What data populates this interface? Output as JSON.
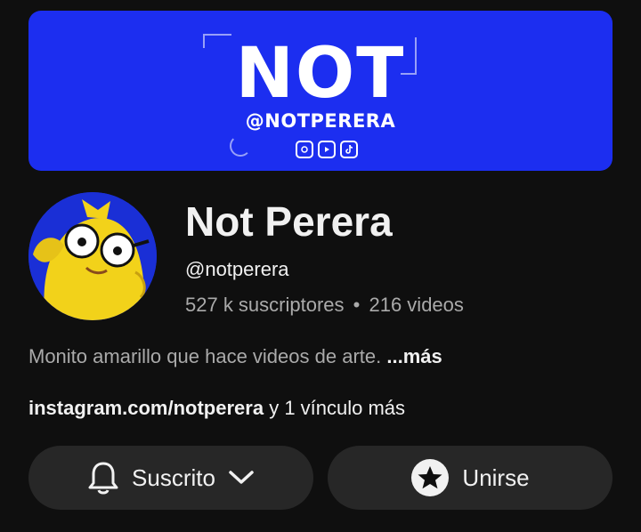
{
  "banner": {
    "title": "NOT",
    "handle": "@NOTPERERA",
    "icons": [
      "instagram-icon",
      "youtube-icon",
      "tiktok-icon"
    ]
  },
  "channel": {
    "name": "Not Perera",
    "handle": "@notperera",
    "subscribers": "527 k suscriptores",
    "separator": "•",
    "videos": "216 videos"
  },
  "description": {
    "text": "Monito amarillo que hace videos de arte.",
    "more": "...más"
  },
  "links": {
    "url": "instagram.com/notperera",
    "suffix": "y 1 vínculo más"
  },
  "actions": {
    "subscribed_label": "Suscrito",
    "join_label": "Unirse"
  },
  "colors": {
    "background": "#0f0f0f",
    "banner": "#1c2ef0",
    "button": "#272727",
    "secondary_text": "#aaaaaa"
  }
}
